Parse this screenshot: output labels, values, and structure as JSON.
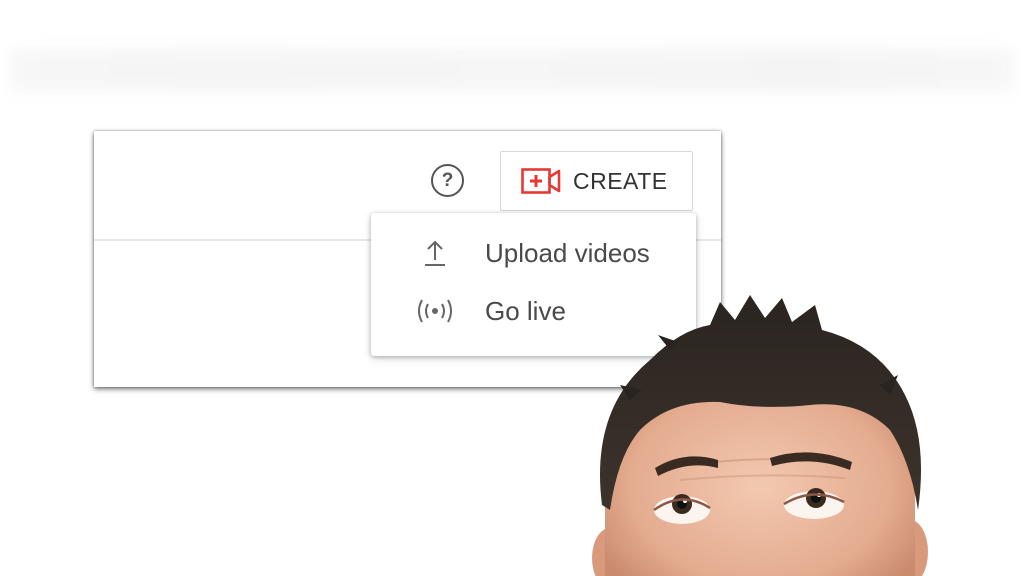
{
  "header": {
    "help_icon": "help-circle-icon",
    "help_glyph": "?",
    "create_button": {
      "label": "CREATE",
      "icon": "video-camera-plus-icon",
      "accent_color": "#e53935"
    }
  },
  "create_menu": {
    "items": [
      {
        "label": "Upload videos",
        "icon": "upload-arrow-icon"
      },
      {
        "label": "Go live",
        "icon": "broadcast-icon"
      }
    ]
  }
}
